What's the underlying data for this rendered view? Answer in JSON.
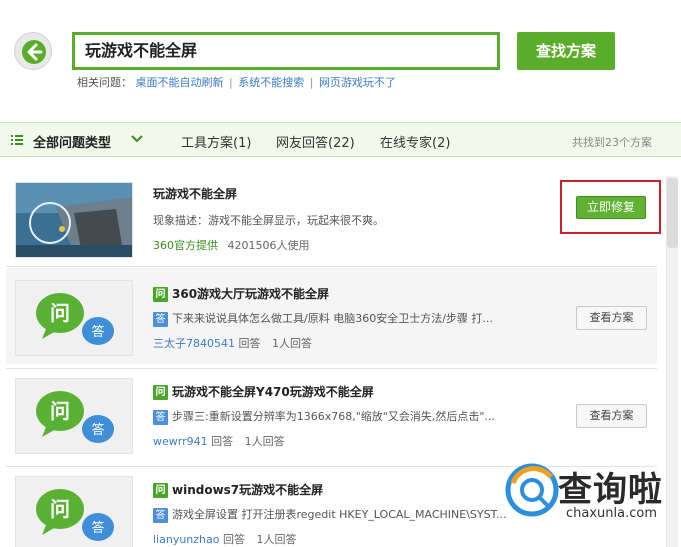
{
  "search": {
    "query": "玩游戏不能全屏",
    "button_label": "查找方案"
  },
  "related": {
    "label": "相关问题：",
    "links": [
      "桌面不能自动刷新",
      "系统不能搜索",
      "网页游戏玩不了"
    ],
    "separator": "|"
  },
  "filter": {
    "all_types": "全部问题类型",
    "tabs": [
      "工具方案(1)",
      "网友回答(22)",
      "在线专家(2)"
    ],
    "found": "共找到23个方案"
  },
  "results": [
    {
      "title": "玩游戏不能全屏",
      "description": "现象描述：游戏不能全屏显示，玩起来很不爽。",
      "provider": "360官方提供",
      "users": "4201506人使用",
      "button": "立即修复"
    },
    {
      "q_tag": "问",
      "a_tag": "答",
      "title": "360游戏大厅玩游戏不能全屏",
      "answer": "下来来说说具体怎么做工具/原料 电脑360安全卫士方法/步骤 打...",
      "user": "三太子7840541",
      "answer_label": "回答",
      "count": "1人回答",
      "button": "查看方案"
    },
    {
      "q_tag": "问",
      "a_tag": "答",
      "title": "玩游戏不能全屏Y470玩游戏不能全屏",
      "answer": "步骤三:重新设置分辨率为1366x768,\"缩放\"又会消失,然后点击\"...",
      "user": "wewrr941",
      "answer_label": "回答",
      "count": "1人回答",
      "button": "查看方案"
    },
    {
      "q_tag": "问",
      "a_tag": "答",
      "title": "windows7玩游戏不能全屏",
      "answer": "游戏全屏设置  打开注册表regedit  HKEY_LOCAL_MACHINE\\SYST...",
      "user": "lianyunzhao",
      "answer_label": "回答",
      "count": "1人回答"
    }
  ],
  "qa_icon": {
    "q": "问",
    "a": "答"
  },
  "watermark": {
    "text": "查询啦",
    "url": "chaxunla.com"
  },
  "colors": {
    "brand_green": "#5aad2b",
    "link_blue": "#3d7cc9",
    "highlight_red": "#c8232c"
  },
  "icons": [
    "back-arrow-icon",
    "menu-list-icon",
    "chevron-down-icon",
    "qa-bubble-icon",
    "watermark-search-logo-icon"
  ]
}
